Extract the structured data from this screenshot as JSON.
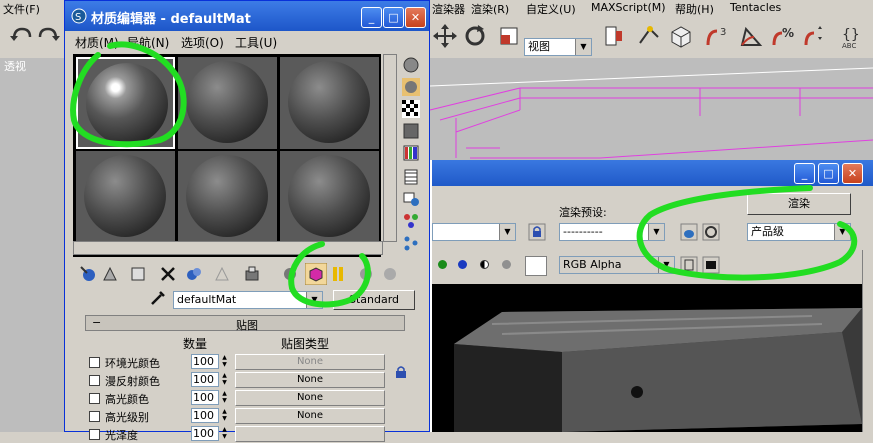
{
  "app_menu": [
    "文件(F)",
    "渲染器",
    "渲染(R)",
    "自定义(U)",
    "MAXScript(M)",
    "帮助(H)",
    "Tentacles"
  ],
  "toolbar": {
    "view_combo": "视图"
  },
  "viewport": {
    "label": "透视"
  },
  "material_editor": {
    "title": "材质编辑器 - defaultMat",
    "menu": [
      "材质(M)",
      "导航(N)",
      "选项(O)",
      "工具(U)"
    ],
    "material_name": "defaultMat",
    "material_type": "Standard",
    "maps_rollout": {
      "title": "贴图",
      "col_amount": "数量",
      "col_type": "贴图类型",
      "rows": [
        {
          "label": "环境光颜色",
          "amount": "100",
          "map": "None"
        },
        {
          "label": "漫反射颜色",
          "amount": "100",
          "map": "None"
        },
        {
          "label": "高光颜色",
          "amount": "100",
          "map": "None"
        },
        {
          "label": "高光级别",
          "amount": "100",
          "map": "None"
        },
        {
          "label": "光泽度",
          "amount": "100",
          "map": ""
        }
      ]
    }
  },
  "render_setup": {
    "preset_label": "渲染预设:",
    "preset_value": "----------",
    "render_button": "渲染",
    "quality_value": "产品级",
    "channel_value": "RGB Alpha"
  },
  "colors": {
    "annotation": "#22dd22",
    "titlebar": "#2a67d8"
  }
}
